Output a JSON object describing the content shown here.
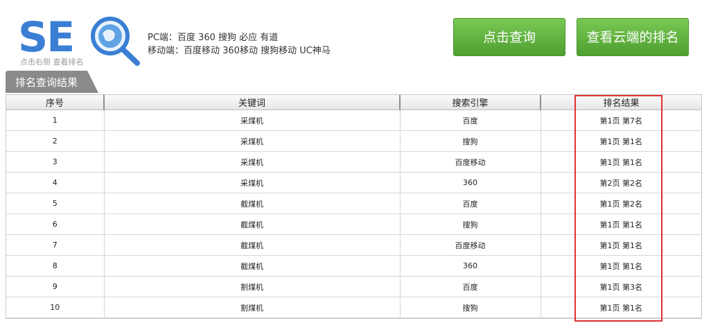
{
  "logo": {
    "text": "SE",
    "caption": "点击右侧 查看排名"
  },
  "engines": {
    "pc": "PC端：百度 360 搜狗 必应 有道",
    "mobile": "移动端：百度移动 360移动 搜狗移动 UC神马"
  },
  "buttons": {
    "query": "点击查询",
    "cloud": "查看云端的排名"
  },
  "tab": {
    "label": "排名查询结果"
  },
  "table": {
    "headers": [
      "序号",
      "关键词",
      "搜索引擎",
      "排名结果"
    ],
    "rows": [
      [
        "1",
        "采煤机",
        "百度",
        "第1页 第7名"
      ],
      [
        "2",
        "采煤机",
        "搜狗",
        "第1页 第1名"
      ],
      [
        "3",
        "采煤机",
        "百度移动",
        "第1页 第1名"
      ],
      [
        "4",
        "采煤机",
        "360",
        "第2页 第2名"
      ],
      [
        "5",
        "截煤机",
        "百度",
        "第1页 第2名"
      ],
      [
        "6",
        "截煤机",
        "搜狗",
        "第1页 第1名"
      ],
      [
        "7",
        "截煤机",
        "百度移动",
        "第1页 第1名"
      ],
      [
        "8",
        "截煤机",
        "360",
        "第1页 第1名"
      ],
      [
        "9",
        "割煤机",
        "百度",
        "第1页 第3名"
      ],
      [
        "10",
        "割煤机",
        "搜狗",
        "第1页 第1名"
      ]
    ]
  },
  "colors": {
    "button_green": "#5bb03b",
    "highlight_red": "#e03030",
    "logo_blue": "#3b7fd4"
  }
}
